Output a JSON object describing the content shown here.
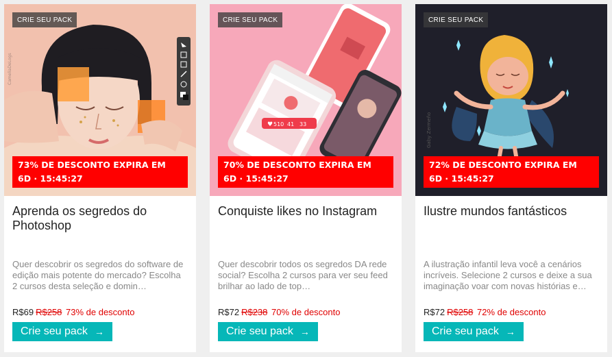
{
  "cards": [
    {
      "badge": "CRIE SEU PACK",
      "promo_line1": "73% DE DESCONTO EXPIRA EM",
      "promo_line2": "6D · 15:45:27",
      "title": "Aprenda os segredos do Photoshop",
      "description": "Quer descobrir os segredos do software de edição mais potente do mercado? Escolha 2 cursos desta seleção e domin…",
      "price": "R$69",
      "old_price": "R$258",
      "discount": "73% de desconto",
      "cta": "Crie seu pack",
      "image_credit": "CameliaDeLogs"
    },
    {
      "badge": "CRIE SEU PACK",
      "promo_line1": "70% DE DESCONTO EXPIRA EM",
      "promo_line2": "6D · 15:45:27",
      "title": "Conquiste likes no Instagram",
      "description": "Quer descobrir todos os segredos DA rede social? Escolha 2 cursos para ver seu feed brilhar ao lado de top…",
      "price": "R$72",
      "old_price": "R$238",
      "discount": "70% de desconto",
      "cta": "Crie seu pack",
      "phone_stats": {
        "likes": "510",
        "comments": "41",
        "followers": "33"
      }
    },
    {
      "badge": "CRIE SEU PACK",
      "promo_line1": "72% DE DESCONTO EXPIRA EM",
      "promo_line2": "6D · 15:45:27",
      "title": "Ilustre mundos fantásticos",
      "description": "A ilustração infantil leva você a cenários incríveis. Selecione 2 cursos e deixe a sua imaginação voar com novas histórias e…",
      "price": "R$72",
      "old_price": "R$258",
      "discount": "72% de desconto",
      "cta": "Crie seu pack",
      "image_credit": "Gaby Zermeño"
    }
  ],
  "colors": {
    "promo": "#ff0000",
    "cta": "#06b7b8",
    "old_price": "#e00000"
  },
  "icons": {
    "cta": "arrow-right-icon"
  }
}
